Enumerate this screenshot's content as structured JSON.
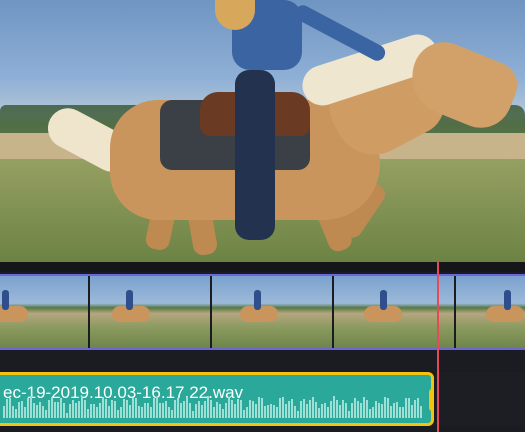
{
  "preview": {
    "scene_icon": "horse-rider-photo"
  },
  "timeline": {
    "audio_clip": {
      "label": "ec-19-2019.10.03-16.17.22.wav"
    },
    "colors": {
      "clip_border": "#f2c40f",
      "audio_fill": "#2aa99b",
      "video_border": "#6b66d9",
      "playhead": "#e5495a"
    }
  }
}
